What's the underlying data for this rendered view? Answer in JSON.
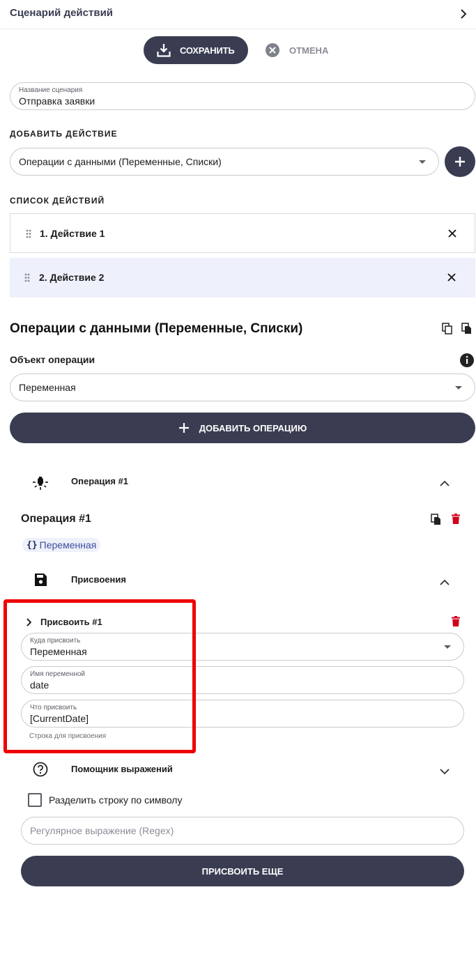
{
  "header": {
    "title": "Сценарий действий"
  },
  "toolbar": {
    "save_label": "СОХРАНИТЬ",
    "cancel_label": "ОТМЕНА"
  },
  "scenario_name": {
    "label": "Название сценария",
    "value": "Отправка заявки"
  },
  "add_action": {
    "caption": "ДОБАВИТЬ ДЕЙСТВИЕ",
    "selected": "Операции с данными (Переменные, Списки)"
  },
  "actions_list": {
    "caption": "СПИСОК ДЕЙСТВИЙ",
    "items": [
      {
        "label": "1. Действие 1"
      },
      {
        "label": "2. Действие 2"
      }
    ]
  },
  "operation_panel": {
    "title": "Операции с данными (Переменные, Списки)",
    "object_label": "Объект операции",
    "object_value": "Переменная",
    "add_operation_label": "ДОБАВИТЬ ОПЕРАЦИЮ"
  },
  "operation": {
    "accordion_label": "Операция #1",
    "title": "Операция #1",
    "chip_icon": "{}",
    "chip_label": "Переменная",
    "assignments_label": "Присвоения"
  },
  "assignment": {
    "title": "Присвоить #1",
    "target": {
      "label": "Куда присвоить",
      "value": "Переменная"
    },
    "var_name": {
      "label": "Имя переменной",
      "value": "date"
    },
    "what": {
      "label": "Что присвоить",
      "value": "[CurrentDate]"
    },
    "helper_text": "Строка для присвоения"
  },
  "expression_helper": {
    "label": "Помощник выражений"
  },
  "split": {
    "label": "Разделить строку по символу"
  },
  "regex": {
    "placeholder": "Регулярное выражение (Regex)"
  },
  "assign_more_label": "ПРИСВОИТЬ ЕЩЕ",
  "colors": {
    "primary": "#3a3d52",
    "delete": "#d0021b",
    "highlight": "#ee0000",
    "selected_row": "#eef1fb"
  }
}
